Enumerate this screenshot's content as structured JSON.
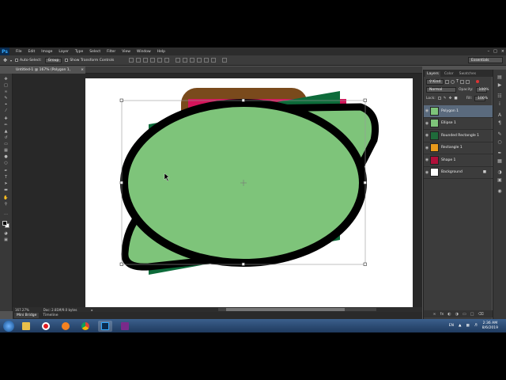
{
  "app": {
    "logo": "Ps",
    "menu": [
      "File",
      "Edit",
      "Image",
      "Layer",
      "Type",
      "Select",
      "Filter",
      "View",
      "Window",
      "Help"
    ]
  },
  "options": {
    "auto_select": "Auto-Select:",
    "auto_select_value": "Group",
    "show_transform": "Show Transform Controls",
    "workspace": "Essentials"
  },
  "document": {
    "tab_title": "Untitled-1 @ 167% (Polygon 1, CMYK/8) *",
    "zoom": "167.27%",
    "doc_size": "Doc: 2.81M/9.0 bytes"
  },
  "bottom_tabs": [
    "Mini Bridge",
    "Timeline"
  ],
  "panels": {
    "tabs": [
      "Layers",
      "Color",
      "Swatches"
    ],
    "filter_kind": "Kind",
    "blend_mode": "Normal",
    "opacity_label": "Opacity:",
    "opacity_value": "100%",
    "lock_label": "Lock:",
    "fill_label": "Fill:",
    "fill_value": "100%",
    "layers": [
      {
        "name": "Polygon 1",
        "thumb": "#7ec47a",
        "active": true
      },
      {
        "name": "Ellipse 1",
        "thumb": "#7ec47a",
        "active": false
      },
      {
        "name": "Rounded Rectangle 1",
        "thumb": "#1f6b3a",
        "active": false
      },
      {
        "name": "Rectangle 1",
        "thumb": "#e89a1c",
        "active": false
      },
      {
        "name": "Shape 1",
        "thumb": "#b0103a",
        "active": false
      },
      {
        "name": "Background",
        "thumb": "#ffffff",
        "active": false
      }
    ]
  },
  "colors": {
    "green_fill": "#7ec47a",
    "dark_green": "#0d6b3a",
    "brown": "#7a4a1c",
    "magenta": "#d4145a",
    "stroke": "#000000"
  },
  "taskbar": {
    "lang": "EN",
    "time": "2:36 AM",
    "date": "8/6/2019"
  }
}
